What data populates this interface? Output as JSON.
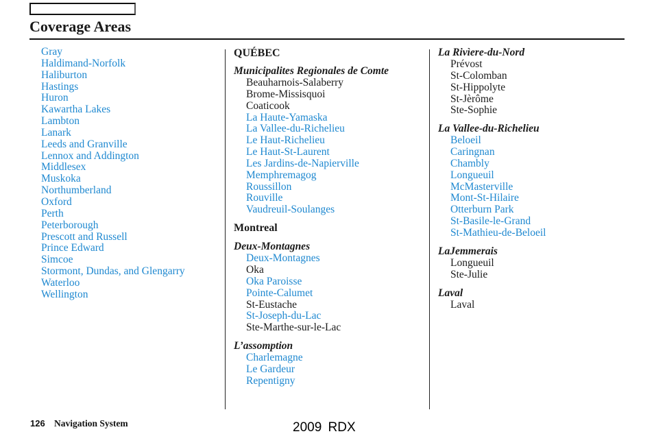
{
  "header": {
    "title": "Coverage Areas"
  },
  "column1": {
    "items": [
      {
        "label": "Gray",
        "link": true
      },
      {
        "label": "Haldimand-Norfolk",
        "link": true
      },
      {
        "label": "Haliburton",
        "link": true
      },
      {
        "label": "Hastings",
        "link": true
      },
      {
        "label": "Huron",
        "link": true
      },
      {
        "label": "Kawartha Lakes",
        "link": true
      },
      {
        "label": "Lambton",
        "link": true
      },
      {
        "label": "Lanark",
        "link": true
      },
      {
        "label": "Leeds and Granville",
        "link": true
      },
      {
        "label": "Lennox and Addington",
        "link": true
      },
      {
        "label": "Middlesex",
        "link": true
      },
      {
        "label": "Muskoka",
        "link": true
      },
      {
        "label": "Northumberland",
        "link": true
      },
      {
        "label": "Oxford",
        "link": true
      },
      {
        "label": "Perth",
        "link": true
      },
      {
        "label": "Peterborough",
        "link": true
      },
      {
        "label": "Prescott and Russell",
        "link": true
      },
      {
        "label": "Prince Edward",
        "link": true
      },
      {
        "label": "Simcoe",
        "link": true
      },
      {
        "label": "Stormont, Dundas, and Glengarry",
        "link": true
      },
      {
        "label": "Waterloo",
        "link": true
      },
      {
        "label": "Wellington",
        "link": true
      }
    ]
  },
  "column2": {
    "province": "QUÉBEC",
    "groups": [
      {
        "type": "region",
        "heading": "Municipalites Regionales de Comte",
        "items": [
          {
            "label": "Beauharnois-Salaberry",
            "link": false
          },
          {
            "label": "Brome-Missisquoi",
            "link": false
          },
          {
            "label": "Coaticook",
            "link": false
          },
          {
            "label": "La Haute-Yamaska",
            "link": true
          },
          {
            "label": "La Vallee-du-Richelieu",
            "link": true
          },
          {
            "label": "Le Haut-Richelieu",
            "link": true
          },
          {
            "label": "Le Haut-St-Laurent",
            "link": true
          },
          {
            "label": "Les Jardins-de-Napierville",
            "link": true
          },
          {
            "label": "Memphremagog",
            "link": true
          },
          {
            "label": "Roussillon",
            "link": true
          },
          {
            "label": "Rouville",
            "link": true
          },
          {
            "label": "Vaudreuil-Soulanges",
            "link": true
          }
        ]
      },
      {
        "type": "city",
        "heading": "Montreal",
        "items": []
      },
      {
        "type": "region",
        "heading": "Deux-Montagnes",
        "items": [
          {
            "label": "Deux-Montagnes",
            "link": true
          },
          {
            "label": "Oka",
            "link": false
          },
          {
            "label": "Oka Paroisse",
            "link": true
          },
          {
            "label": "Pointe-Calumet",
            "link": true
          },
          {
            "label": "St-Eustache",
            "link": false
          },
          {
            "label": "St-Joseph-du-Lac",
            "link": true
          },
          {
            "label": "Ste-Marthe-sur-le-Lac",
            "link": false
          }
        ]
      },
      {
        "type": "region",
        "heading": "L’assomption",
        "items": [
          {
            "label": "Charlemagne",
            "link": true
          },
          {
            "label": "Le Gardeur",
            "link": true
          },
          {
            "label": "Repentigny",
            "link": true
          }
        ]
      }
    ]
  },
  "column3": {
    "groups": [
      {
        "type": "region",
        "heading": "La Rivìere-du-Nord",
        "items": [
          {
            "label": "Prévost",
            "link": false
          },
          {
            "label": "St-Colomban",
            "link": false
          },
          {
            "label": "St-Hippolyte",
            "link": false
          },
          {
            "label": "St-Jèrôme",
            "link": false
          },
          {
            "label": "Ste-Sophie",
            "link": false
          }
        ]
      },
      {
        "type": "region",
        "heading": "La Vallee-du-Richelieu",
        "items": [
          {
            "label": "Beloeil",
            "link": true
          },
          {
            "label": "Caringnan",
            "link": true
          },
          {
            "label": "Chambly",
            "link": true
          },
          {
            "label": "Longueuil",
            "link": true
          },
          {
            "label": "McMasterville",
            "link": true
          },
          {
            "label": "Mont-St-Hilaire",
            "link": true
          },
          {
            "label": "Otterburn Park",
            "link": true
          },
          {
            "label": "St-Basile-le-Grand",
            "link": true
          },
          {
            "label": "St-Mathieu-de-Beloeil",
            "link": true
          }
        ]
      },
      {
        "type": "region",
        "heading": "LaJemmerais",
        "items": [
          {
            "label": "Longueuil",
            "link": false
          },
          {
            "label": "Ste-Julie",
            "link": false
          }
        ]
      },
      {
        "type": "region",
        "heading": "Laval",
        "items": [
          {
            "label": "Laval",
            "link": false
          }
        ]
      }
    ]
  },
  "footer": {
    "page_number": "126",
    "section": "Navigation System",
    "model": "2009  RDX"
  },
  "colors": {
    "link": "#1e88d0",
    "text": "#1a1a1a"
  }
}
